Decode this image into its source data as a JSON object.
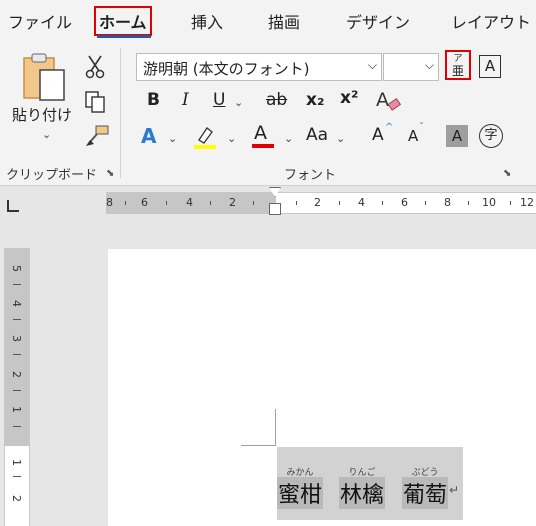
{
  "tabs": [
    "ファイル",
    "ホーム",
    "挿入",
    "描画",
    "デザイン",
    "レイアウト"
  ],
  "active_tab": "ホーム",
  "clipboard": {
    "paste_label": "貼り付け",
    "group_label": "クリップボード"
  },
  "font_group": {
    "font_name": "游明朝 (本文のフォント)",
    "font_size": "",
    "group_label": "フォント",
    "phonetic_guide_glyph_top": "ア",
    "phonetic_guide_glyph_bottom": "亜",
    "bold": "B",
    "italic": "I",
    "underline": "U",
    "strike": "ab",
    "subscript": "x₂",
    "superscript": "x²",
    "text_effect": "A",
    "font_color": "A",
    "change_case": "Aa",
    "grow": "A",
    "shrink": "A",
    "enclose_char": "字",
    "char_border": "A",
    "char_shading": "A"
  },
  "colors": {
    "accent_red": "#e00000",
    "tab_underline": "#2b579a",
    "highlight": "#ffff00",
    "font_color_bar": "#e00000"
  },
  "ruler": {
    "horizontal": [
      "8",
      "6",
      "4",
      "2",
      "2",
      "4",
      "6",
      "8",
      "10",
      "12"
    ],
    "vertical": [
      "5",
      "4",
      "3",
      "2",
      "1",
      "1",
      "2"
    ]
  },
  "document": {
    "words": [
      {
        "ruby": "みかん",
        "text": "蜜柑"
      },
      {
        "ruby": "りんご",
        "text": "林檎"
      },
      {
        "ruby": "ぶどう",
        "text": "葡萄"
      }
    ],
    "paragraph_mark": "↵"
  }
}
